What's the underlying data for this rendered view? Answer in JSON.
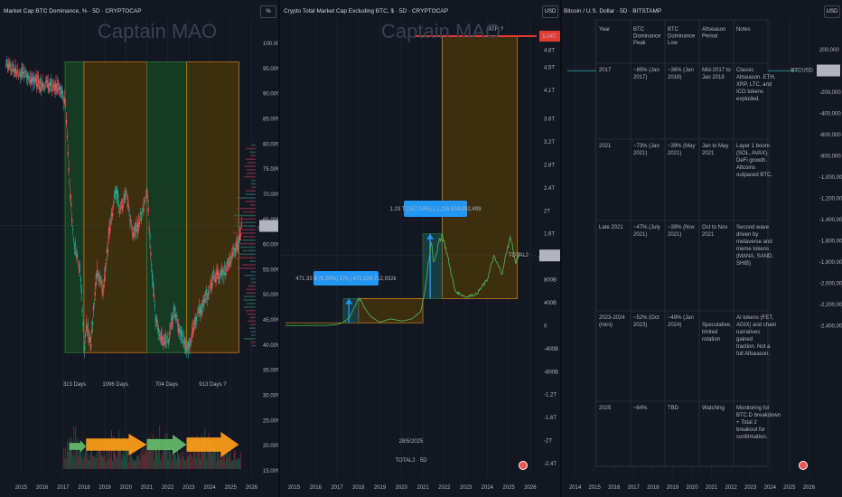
{
  "panels": {
    "left": {
      "header": "Market Cap BTC Dominance, % · 5D · CRYPTOCAP",
      "currency": "%",
      "brand": "Captain MAO",
      "price_badge": "63.78%",
      "price_badge_sub": "04:23:59"
    },
    "middle": {
      "header": "Crypto Total Market Cap Excluding BTC, $ · 5D · CRYPTOCAP",
      "currency": "USD",
      "brand": "Captain MAO",
      "ath_label": "ATH ?",
      "ath_badge": "5.04T",
      "price_badge": "1.23T",
      "price_badge_sub": "04:23:59",
      "total2_tag": "TOTAL2",
      "measure1": "471.33 B (6.29%) 17h | 471,226,712,932k",
      "measure2": "1.23 T (257.24%) | 1,226,934,092,499",
      "watermark_line1": "28/5/2025",
      "watermark_line2": "TOTAL2 · 5D"
    },
    "right": {
      "header": "Bitcoin / U.S. Dollar · 5D · BITSTAMP",
      "currency": "USD",
      "price_badge": "109,779",
      "price_badge_sub": "04:23:59",
      "btc_tag": "BTCUSD"
    }
  },
  "colors": {
    "background": "#131722",
    "bull_zone": "#163a24",
    "bear_zone": "#3d2e10",
    "green": "#26a69a",
    "red": "#ef5350",
    "orange_arrow": "#ff9f1a",
    "green_arrow": "#66bb6a",
    "measure_blue": "#2196f3",
    "ath_red": "#e53935"
  },
  "chart_data": [
    {
      "type": "line",
      "title": "Market Cap BTC Dominance, % · 5D · CRYPTOCAP",
      "ylabel": "%",
      "ylim": [
        15,
        100
      ],
      "y_ticks": [
        "100.00%",
        "95.00%",
        "90.00%",
        "85.00%",
        "80.00%",
        "75.00%",
        "70.00%",
        "65.00%",
        "60.00%",
        "55.00%",
        "50.00%",
        "45.00%",
        "40.00%",
        "35.00%",
        "30.00%",
        "25.00%",
        "20.00%",
        "15.00%"
      ],
      "x_ticks": [
        "2015",
        "2016",
        "2017",
        "2018",
        "2019",
        "2020",
        "2021",
        "2022",
        "2023",
        "2024",
        "2025",
        "2026"
      ],
      "zones": [
        {
          "label": "313 Days",
          "from": 2017.1,
          "to": 2018.0,
          "kind": "bull"
        },
        {
          "label": "1096 Days",
          "from": 2018.0,
          "to": 2021.0,
          "kind": "bear"
        },
        {
          "label": "704 Days",
          "from": 2021.0,
          "to": 2022.9,
          "kind": "bull"
        },
        {
          "label": "913 Days ?",
          "from": 2022.9,
          "to": 2025.4,
          "kind": "bear"
        }
      ],
      "zone_range": [
        38.5,
        96.3
      ],
      "series": [
        {
          "x": [
            2014.2,
            2015.0,
            2016.0,
            2016.8,
            2017.1,
            2017.3,
            2017.5,
            2017.8,
            2018.0,
            2018.1,
            2018.3,
            2018.6,
            2018.9,
            2019.2,
            2019.5,
            2019.7,
            2020.0,
            2020.3,
            2020.6,
            2020.9,
            2021.0,
            2021.2,
            2021.4,
            2021.7,
            2022.0,
            2022.3,
            2022.6,
            2022.9,
            2023.2,
            2023.5,
            2023.9,
            2024.2,
            2024.6,
            2024.9,
            2025.1,
            2025.4,
            2025.5
          ],
          "values": [
            96,
            94,
            92,
            91,
            88,
            72,
            60,
            55,
            38.5,
            44,
            40,
            55,
            51,
            63,
            71,
            67,
            70,
            62,
            64,
            69,
            71,
            56,
            45,
            41,
            41,
            47,
            42,
            39,
            43,
            47,
            50,
            54,
            54,
            56,
            58,
            61,
            63.78
          ]
        }
      ]
    },
    {
      "type": "line",
      "title": "Crypto Total Market Cap Excluding BTC, $ · 5D · CRYPTOCAP",
      "ylabel": "USD",
      "y_ticks": [
        "4.8T",
        "4.5T",
        "4.1T",
        "3.6T",
        "3.2T",
        "2.8T",
        "2.4T",
        "2T",
        "1.6T",
        "1.2T",
        "800B",
        "400B",
        "0",
        "-400B",
        "-800B",
        "-1.2T",
        "-1.6T",
        "-2T",
        "-2.4T"
      ],
      "x_ticks": [
        "2015",
        "2016",
        "2017",
        "2018",
        "2019",
        "2020",
        "2021",
        "2022",
        "2023",
        "2024",
        "2025",
        "2026"
      ],
      "ath": 5.04,
      "series": [
        {
          "x": [
            2014.5,
            2016.5,
            2017.0,
            2017.3,
            2017.6,
            2017.9,
            2018.0,
            2018.1,
            2018.3,
            2018.6,
            2019.0,
            2019.5,
            2020.0,
            2020.5,
            2020.9,
            2021.1,
            2021.3,
            2021.4,
            2021.5,
            2021.8,
            2021.9,
            2022.1,
            2022.5,
            2023.0,
            2023.5,
            2024.0,
            2024.3,
            2024.7,
            2024.9,
            2025.1,
            2025.3,
            2025.5
          ],
          "values": [
            0.003,
            0.005,
            0.02,
            0.06,
            0.15,
            0.4,
            0.47,
            0.45,
            0.3,
            0.15,
            0.06,
            0.12,
            0.08,
            0.12,
            0.25,
            0.6,
            1.2,
            1.5,
            1.1,
            1.5,
            1.6,
            1.3,
            0.6,
            0.5,
            0.55,
            0.8,
            1.2,
            0.9,
            1.3,
            1.55,
            1.1,
            1.23
          ]
        }
      ]
    },
    {
      "type": "table",
      "title": "Bitcoin / U.S. Dollar · 5D · BITSTAMP",
      "columns": [
        "Year",
        "BTC Dominance Peak",
        "BTC Dominance Low",
        "Altseason Period",
        "Notes"
      ],
      "rows": [
        [
          "2017",
          "~85% (Jan 2017)",
          "~36% (Jan 2018)",
          "Mid-2017 to Jan 2018",
          "Classic Altseason. ETH, XRP, LTC, and ICO tokens exploded."
        ],
        [
          "2021",
          "~73% (Jan 2021)",
          "~39% (May 2021)",
          "Jan to May 2021",
          "Layer 1 boom (SOL, AVAX), DeFi growth. Altcoins outpaced BTC."
        ],
        [
          "Late 2021",
          "~47% (July 2021)",
          "~39% (Nov 2021)",
          "Oct to Nov 2021",
          "Second wave driven by metaverse and meme tokens (MANA, SAND, SHIB)"
        ],
        [
          "2023-2024 (mini)",
          "~52% (Oct 2023)",
          "~49% (Jan 2024)",
          "Speculative, limited rotation",
          "AI tokens (FET, AGIX) and chain narratives gained traction. Not a full Altseason."
        ],
        [
          "2025",
          "~64%",
          "TBD",
          "Watching",
          "Monitoring for BTC.D breakdown + Total 2 breakout for confirmation."
        ]
      ],
      "y_ticks": [
        "200,000",
        "0",
        "-200,000",
        "-400,000",
        "-600,000",
        "-800,000",
        "-1,000,000",
        "-1,200,000",
        "-1,400,000",
        "-1,600,000",
        "-1,800,000",
        "-2,000,000",
        "-2,200,000",
        "-2,400,000"
      ],
      "x_ticks": [
        "2014",
        "2015",
        "2016",
        "2017",
        "2018",
        "2019",
        "2020",
        "2021",
        "2022",
        "2023",
        "2024",
        "2025",
        "2026"
      ]
    }
  ]
}
